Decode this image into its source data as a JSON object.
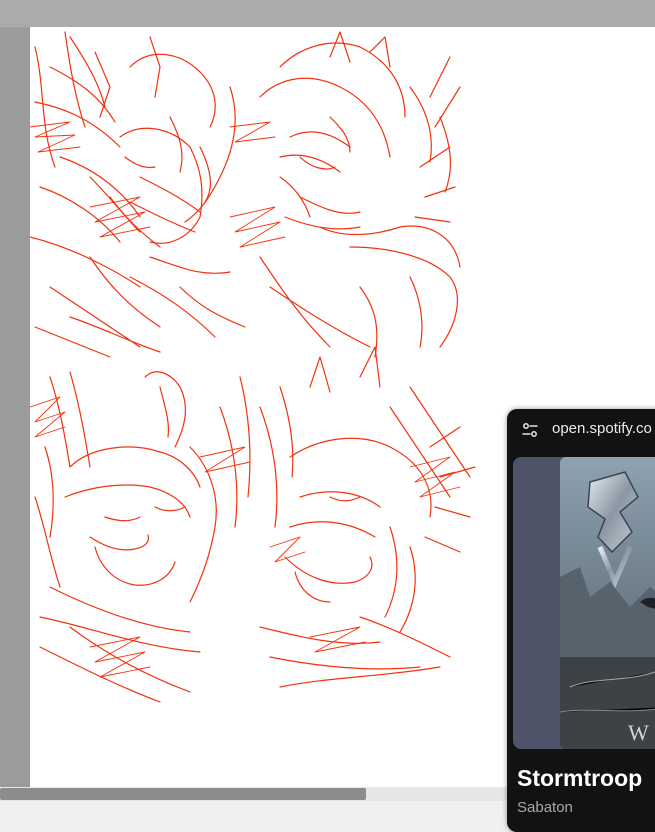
{
  "app": {
    "colors": {
      "canvas_bg": "#ababab",
      "page": "#ffffff",
      "sketch_stroke": "#f2320f",
      "pip_bg": "#121212"
    }
  },
  "miniplayer": {
    "url": "open.spotify.co",
    "track_title": "Stormtroop",
    "artist": "Sabaton",
    "icons": {
      "settings": "tune-icon"
    }
  }
}
